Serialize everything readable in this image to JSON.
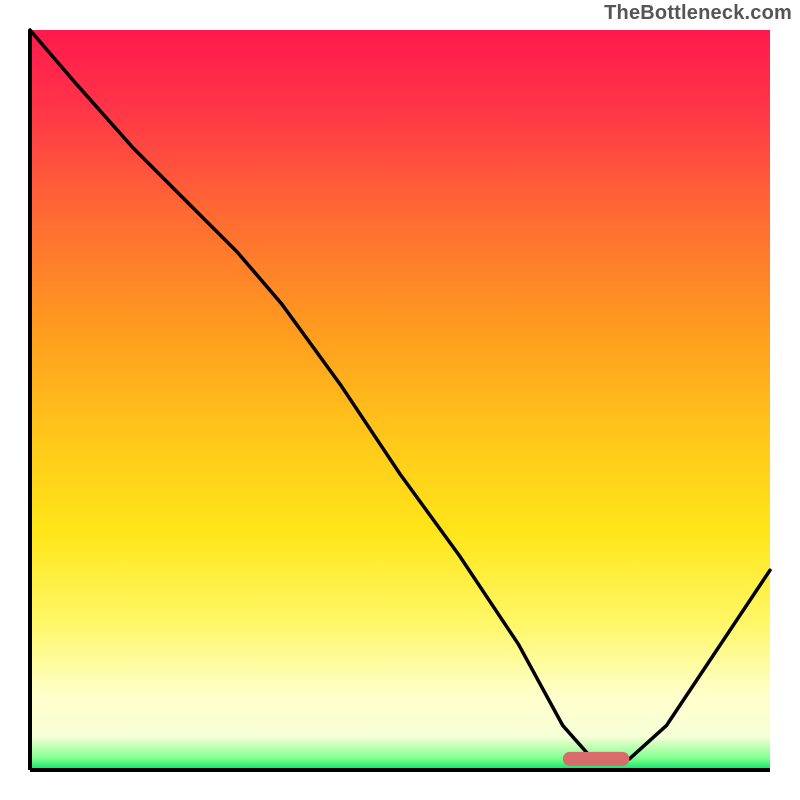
{
  "attribution": "TheBottleneck.com",
  "plot": {
    "inner_x": 30,
    "inner_y": 30,
    "inner_w": 740,
    "inner_h": 740
  },
  "gradient_stops": [
    {
      "offset": 0.0,
      "color": "#ff1a4d"
    },
    {
      "offset": 0.1,
      "color": "#ff3348"
    },
    {
      "offset": 0.25,
      "color": "#ff6a33"
    },
    {
      "offset": 0.4,
      "color": "#ff9a1f"
    },
    {
      "offset": 0.55,
      "color": "#ffc71a"
    },
    {
      "offset": 0.68,
      "color": "#ffe61a"
    },
    {
      "offset": 0.8,
      "color": "#fff766"
    },
    {
      "offset": 0.9,
      "color": "#ffffcc"
    },
    {
      "offset": 0.955,
      "color": "#f7ffd6"
    },
    {
      "offset": 0.985,
      "color": "#7dff8c"
    },
    {
      "offset": 1.0,
      "color": "#00e36b"
    }
  ],
  "marker": {
    "x0_frac": 0.72,
    "x1_frac": 0.81,
    "y_frac": 0.985,
    "color": "#d86b6b",
    "thickness": 14,
    "radius": 7
  },
  "chart_data": {
    "type": "line",
    "title": "",
    "xlabel": "",
    "ylabel": "",
    "xlim": [
      0,
      1
    ],
    "ylim": [
      0,
      1
    ],
    "note": "x is fractional horizontal position (0=left axis, 1=right axis); y is bottleneck level (0=bottom/green/good, 1=top/red/bad). Values estimated from pixel positions on the gradient.",
    "series": [
      {
        "name": "bottleneck-curve",
        "x": [
          0.0,
          0.06,
          0.14,
          0.22,
          0.28,
          0.34,
          0.42,
          0.5,
          0.58,
          0.66,
          0.72,
          0.76,
          0.81,
          0.86,
          0.92,
          1.0
        ],
        "y": [
          1.0,
          0.93,
          0.84,
          0.76,
          0.7,
          0.63,
          0.52,
          0.4,
          0.29,
          0.17,
          0.06,
          0.015,
          0.015,
          0.06,
          0.15,
          0.27
        ]
      }
    ],
    "optimal_range_x": [
      0.72,
      0.81
    ]
  }
}
